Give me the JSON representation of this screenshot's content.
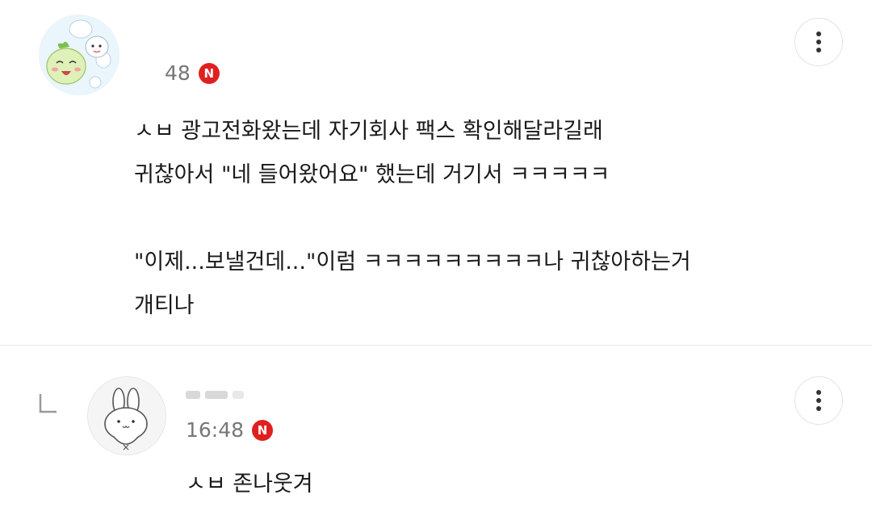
{
  "comment": {
    "time": "48",
    "badge_label": "N",
    "lines": [
      "ㅅㅂ 광고전화왔는데 자기회사 팩스 확인해달라길래",
      "귀찮아서 \"네 들어왔어요\" 했는데 거기서 ㅋㅋㅋㅋㅋ",
      "",
      "\"이제...보낼건데...\"이럼 ㅋㅋㅋㅋㅋㅋㅋㅋㅋ나 귀찮아하는거",
      "개티나"
    ],
    "avatar_icon": "cartoon-characters-avatar",
    "more_icon": "more-vertical-icon"
  },
  "reply": {
    "time": "16:48",
    "badge_label": "N",
    "text": "ㅅㅂ 존나웃겨",
    "avatar_icon": "bunny-avatar",
    "reply_icon": "reply-corner-icon",
    "more_icon": "more-vertical-icon"
  },
  "colors": {
    "badge": "#e02020",
    "meta_text": "#777777",
    "divider": "#e6e6e6"
  }
}
